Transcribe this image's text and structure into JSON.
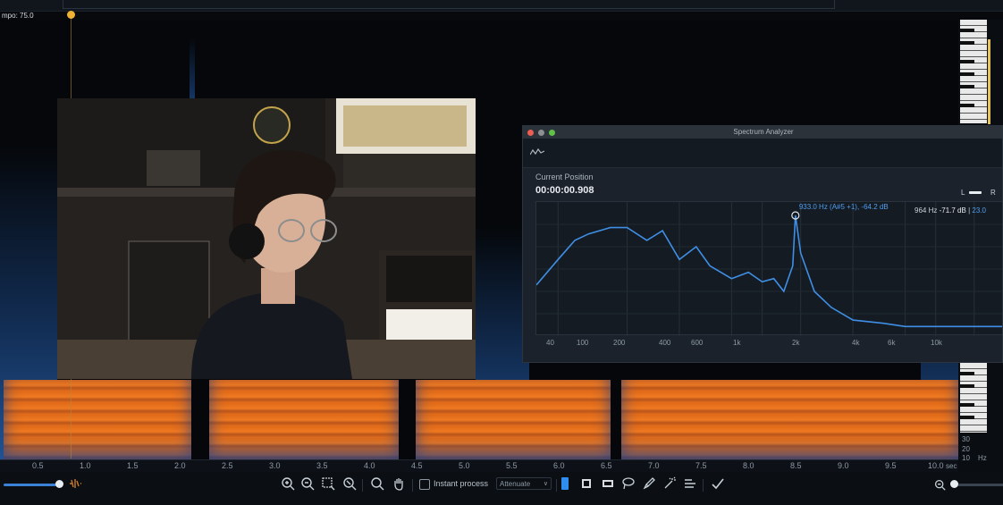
{
  "top": {
    "tempo_label": "mpo: 75.0"
  },
  "timeline": {
    "ticks": [
      "0.5",
      "1.0",
      "1.5",
      "2.0",
      "2.5",
      "3.0",
      "3.5",
      "4.0",
      "4.5",
      "5.0",
      "5.5",
      "6.0",
      "6.5",
      "7.0",
      "7.5",
      "8.0",
      "8.5",
      "9.0",
      "9.5",
      "10.0"
    ],
    "unit": "sec"
  },
  "right_panel": {
    "hz_labels": [
      "30",
      "20",
      "10",
      "Hz"
    ]
  },
  "toolbar": {
    "instant_process_label": "Instant process",
    "mode_value": "Attenuate",
    "mode_chevron": "∨"
  },
  "spectrum_analyzer": {
    "title": "Spectrum Analyzer",
    "current_position_label": "Current Position",
    "current_time": "00:00:00.908",
    "channel_l": "L",
    "channel_r": "R",
    "readout_freq": "964 Hz",
    "readout_db": "-71.7 dB",
    "readout_extra": "23.0",
    "cursor_label_1": "933.0 Hz (A#5 +1), -64.2 dB",
    "cursor_label_2": "933.0 Hz (A#5 +1), -64.2 dB",
    "x_ticks": [
      "40",
      "100",
      "200",
      "400",
      "600",
      "1k",
      "2k",
      "4k",
      "6k",
      "10k"
    ],
    "colors": {
      "trace": "#3f8fe6",
      "cursor_text_2": "#4f9ef0"
    }
  },
  "chart_data": {
    "type": "line",
    "title": "",
    "xlabel": "",
    "ylabel": "",
    "x_scale": "log",
    "x": [
      30,
      40,
      50,
      60,
      80,
      100,
      130,
      160,
      200,
      250,
      300,
      400,
      500,
      600,
      700,
      800,
      900,
      933,
      1000,
      1200,
      1500,
      2000,
      3000,
      4000,
      6000,
      10000,
      15000
    ],
    "series": [
      {
        "values": [
          -86,
          -78,
          -72,
          -70,
          -68,
          -68,
          -72,
          -69,
          -78,
          -74,
          -80,
          -84,
          -82,
          -85,
          -84,
          -88,
          -80,
          -64.2,
          -76,
          -88,
          -93,
          -97,
          -98,
          -99,
          -99,
          -99,
          -99
        ]
      }
    ]
  }
}
